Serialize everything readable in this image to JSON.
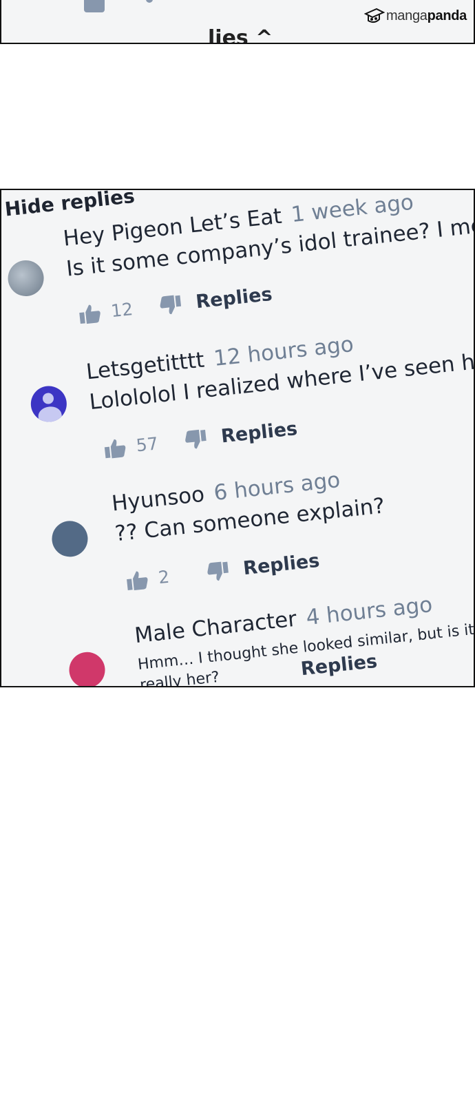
{
  "watermark": {
    "part1": "manga",
    "part2": "panda"
  },
  "top_panel": {
    "fragment_text": "lies ^"
  },
  "thread": {
    "hide_replies_label": "Hide replies",
    "replies_label": "Replies",
    "comments": [
      {
        "username": "Hey Pigeon Let’s Eat",
        "time": "1 week ago",
        "text": "Is it some company’s idol trainee? I mea",
        "likes": "12",
        "avatar_color": "#8a97a6"
      },
      {
        "username": "Letsgetitttt",
        "time": "12 hours ago",
        "text": "Lolololol I realized where I’ve seen he",
        "likes": "57",
        "avatar_color": "#3c35c4"
      },
      {
        "username": "Hyunsoo",
        "time": "6 hours ago",
        "text": "?? Can someone explain?",
        "likes": "2",
        "avatar_color": "#536a86"
      },
      {
        "username": "Male Character",
        "time": "4 hours ago",
        "text": "Hmm… I thought she looked similar, but is it",
        "text2": "really her?",
        "avatar_color": "#d0386a"
      }
    ]
  },
  "colors": {
    "icon_gray": "#8797ad",
    "time_gray": "#6f7f94",
    "text_dark": "#1f2633"
  }
}
